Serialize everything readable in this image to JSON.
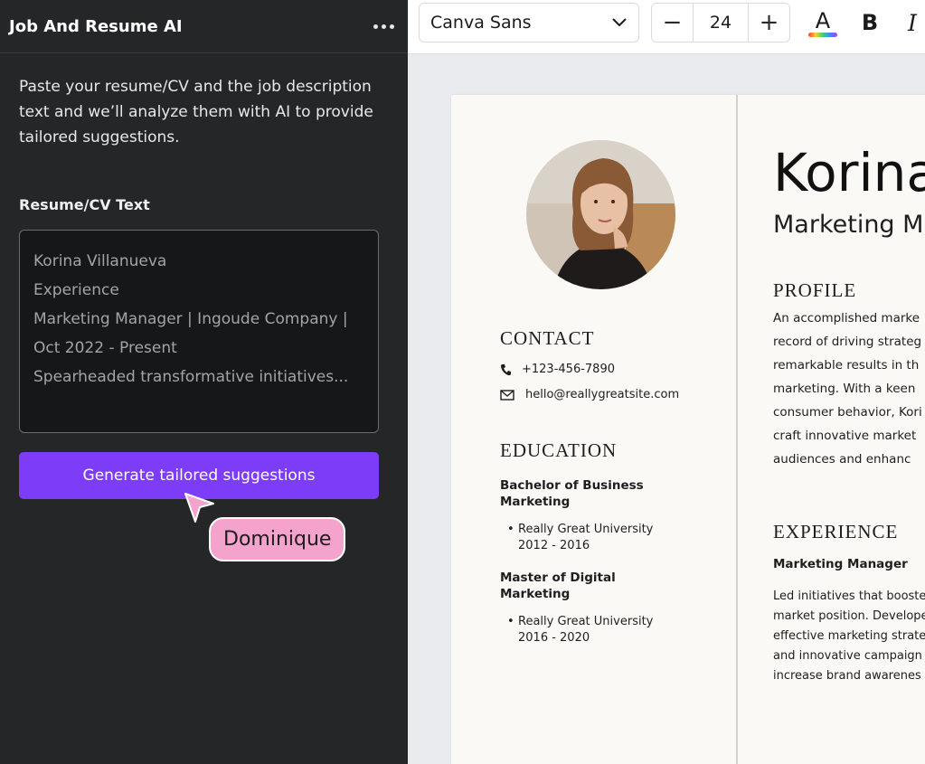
{
  "panel": {
    "title": "Job And Resume AI",
    "intro": "Paste your resume/CV and the job description text and we’ll analyze them with AI to provide tailored suggestions.",
    "field_label": "Resume/CV Text",
    "resume_lines": [
      "Korina Villanueva",
      "Experience",
      "Marketing Manager | Ingoude Company |",
      "Oct 2022 - Present",
      "Spearheaded transformative initiatives..."
    ],
    "generate_label": "Generate tailored suggestions",
    "collaborator_name": "Dominique",
    "collaborator_color": "#f4a3cc",
    "button_color": "#7d3cf8"
  },
  "toolbar": {
    "font_name": "Canva Sans",
    "font_size": "24",
    "minus_label": "−",
    "plus_label": "+",
    "color_letter": "A",
    "bold_label": "B",
    "italic_label": "I"
  },
  "resume": {
    "name": "Korina",
    "role": "Marketing M",
    "contact_heading": "CONTACT",
    "phone": "+123-456-7890",
    "email": "hello@reallygreatsite.com",
    "education_heading": "EDUCATION",
    "education": [
      {
        "degree_line1": "Bachelor of Business",
        "degree_line2": "Marketing",
        "school": "Really Great University",
        "years": "2012 - 2016"
      },
      {
        "degree_line1": "Master of Digital",
        "degree_line2": "Marketing",
        "school": "Really Great University",
        "years": "2016 - 2020"
      }
    ],
    "profile_heading": "PROFILE",
    "profile_lines": [
      "An accomplished marke",
      "record of driving strateg",
      "remarkable results in th",
      "marketing. With a keen",
      "consumer behavior, Kori",
      "craft innovative market",
      "audiences and enhanc"
    ],
    "experience_heading": "EXPERIENCE",
    "job_title": "Marketing Manager",
    "experience_lines": [
      "Led initiatives that booste",
      "market position. Develope",
      "effective marketing strate",
      "and innovative campaign",
      "increase brand awarenes"
    ]
  }
}
